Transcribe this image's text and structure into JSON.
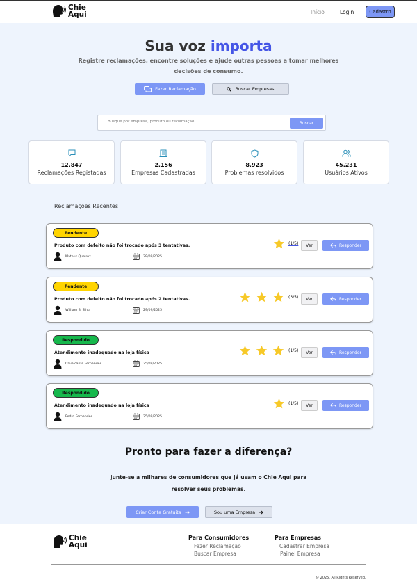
{
  "header": {
    "logo_line1": "Chie",
    "logo_line2": "Aqui",
    "nav": [
      {
        "label": "Início"
      },
      {
        "label": "Login"
      },
      {
        "label": "Cadastro"
      }
    ]
  },
  "hero": {
    "title_part1": "Sua voz",
    "title_accent": "importa",
    "subtitle": "Registre reclamações, encontre soluções e ajude outras pessoas a tomar melhores decisões de consumo.",
    "primary_button": "Fazer Reclamação",
    "secondary_button": "Buscar Empresas"
  },
  "search": {
    "placeholder": "Busque por empresa, produto ou reclamação",
    "button": "Buscar"
  },
  "stats": [
    {
      "icon": "chat-icon",
      "value": "12.847",
      "label": "Reclamações Registadas"
    },
    {
      "icon": "building-icon",
      "value": "2.156",
      "label": "Empresas Cadastradas"
    },
    {
      "icon": "shield-icon",
      "value": "8.923",
      "label": "Problemas resolvidos"
    },
    {
      "icon": "users-icon",
      "value": "45.231",
      "label": "Usuários Ativos"
    }
  ],
  "recent": {
    "title": "Reclamações Recentes",
    "items": [
      {
        "status": "Pendente",
        "title": "Produto com defeito não foi trocado após 3 tentativas.",
        "user": "Mateus Queiroz",
        "date": "29/09/2025",
        "stars": 1,
        "rating": "(1/5)",
        "view": "Ver",
        "reply": "Responder"
      },
      {
        "status": "Pendente",
        "title": "Produto com defeito não foi trocado após 2 tentativas.",
        "user": "William B. Silva",
        "date": "29/09/2025",
        "stars": 3,
        "rating": "(3/5)",
        "view": "Ver",
        "reply": "Responder"
      },
      {
        "status": "Respondido",
        "title": "Atendimento inadequado na loja física",
        "user": "Cavalcante Fernandes",
        "date": "25/09/2025",
        "stars": 3,
        "rating": "(1/5)",
        "view": "Ver",
        "reply": "Responder"
      },
      {
        "status": "Respondido",
        "title": "Atendimento inadequado na loja física",
        "user": "Pedro Fernandes",
        "date": "25/09/2025",
        "stars": 1,
        "rating": "(1/5)",
        "view": "Ver",
        "reply": "Responder"
      }
    ]
  },
  "cta": {
    "title": "Pronto para fazer a diferença?",
    "subtitle": "Junte-se a milhares de consumidores que já usam o Chie Aqui para resolver seus problemas.",
    "primary_button": "Criar Conta Gratuita",
    "secondary_button": "Sou uma Empresa"
  },
  "footer": {
    "logo_line1": "Chie",
    "logo_line2": "Aqui",
    "consumers_title": "Para Consumidores",
    "consumers_links": [
      "Fazer Reclamação",
      "Buscar Empresa"
    ],
    "business_title": "Para Empresas",
    "business_links": [
      "Cadastrar Empresa",
      "Painel Empresa"
    ],
    "copyright": "© 2025. All Rights Reserved."
  },
  "colors": {
    "accent": "#4556e6",
    "button": "#7d97f5",
    "pending": "#ffd400",
    "answered": "#16b84c",
    "star": "#f7c928",
    "background": "#eef4fd"
  }
}
